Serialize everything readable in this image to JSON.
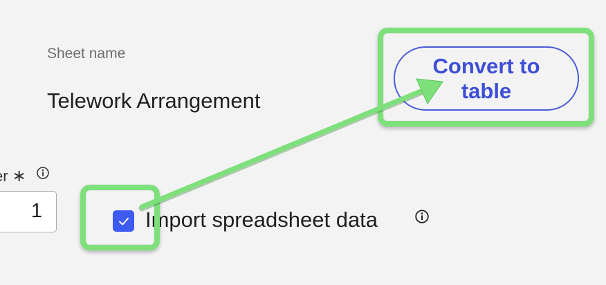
{
  "sheet": {
    "name_label": "Sheet name",
    "name_value": "Telework Arrangement"
  },
  "header_row": {
    "label": "er",
    "required_mark": "∗",
    "value": "1",
    "info_icon": "info-icon"
  },
  "import": {
    "checked": true,
    "label": "Import spreadsheet data",
    "info_icon": "info-icon"
  },
  "actions": {
    "convert_label": "Convert to table"
  },
  "colors": {
    "accent": "#3d5af1",
    "highlight": "#7ee07a",
    "background": "#f3f3f4"
  }
}
